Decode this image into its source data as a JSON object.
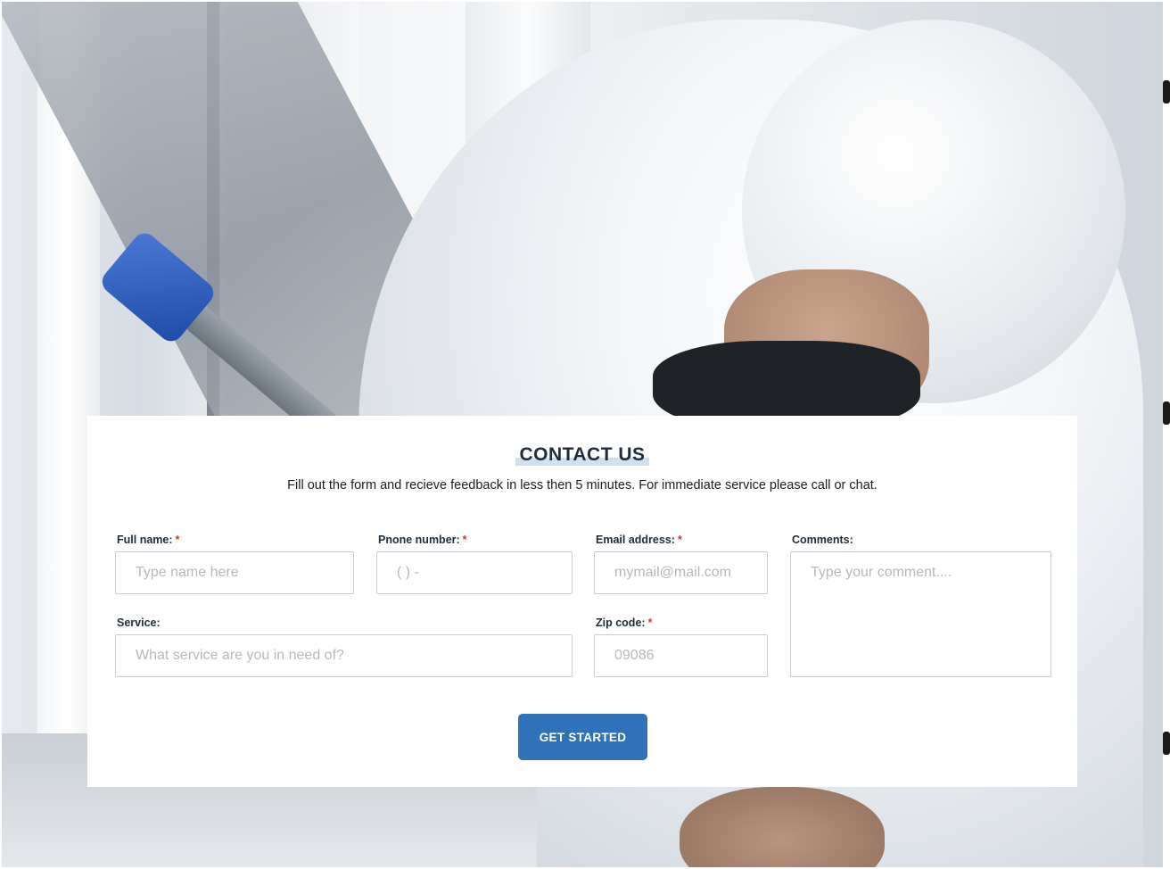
{
  "contact": {
    "title": "CONTACT US",
    "subtitle": "Fill out the form and recieve feedback in less then 5 minutes. For immediate service please call or chat.",
    "required_mark": "*",
    "fields": {
      "full_name": {
        "label": "Full name:",
        "placeholder": "Type name here",
        "required": true
      },
      "phone": {
        "label": "Pnone number:",
        "placeholder": "( ) -",
        "required": true
      },
      "email": {
        "label": "Email address:",
        "placeholder": "mymail@mail.com",
        "required": true
      },
      "comments": {
        "label": "Comments:",
        "placeholder": "Type your comment....",
        "required": false
      },
      "service": {
        "label": "Service:",
        "placeholder": "What service are you in need of?",
        "required": false
      },
      "zip": {
        "label": "Zip code:",
        "placeholder": "09086",
        "required": true
      }
    },
    "submit_label": "GET STARTED",
    "colors": {
      "accent": "#2e72b8",
      "heading": "#1e2d3b",
      "required": "#d43a2a"
    }
  },
  "background": {
    "image": "hazmat-worker-disinfecting-photo"
  }
}
